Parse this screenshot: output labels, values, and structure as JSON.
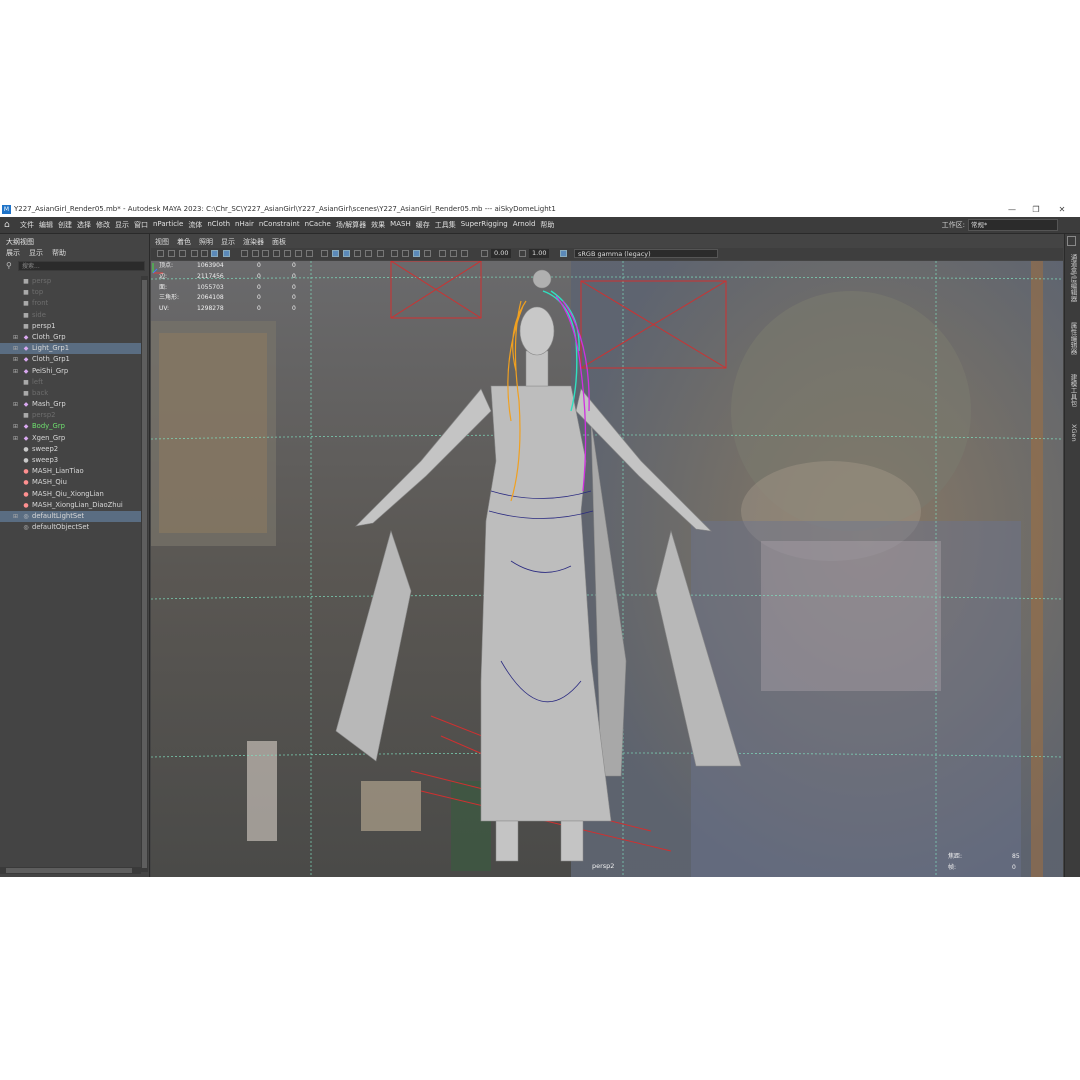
{
  "title_bar": {
    "text": "Y227_AsianGirl_Render05.mb* - Autodesk MAYA 2023: C:\\Chr_SC\\Y227_AsianGirl\\Y227_AsianGirl\\scenes\\Y227_AsianGirl_Render05.mb   ---   aiSkyDomeLight1",
    "icon": "maya-app-icon",
    "minimize": "—",
    "maximize": "❐",
    "close": "✕"
  },
  "menu_bar": {
    "items": [
      "文件",
      "编辑",
      "创建",
      "选择",
      "修改",
      "显示",
      "窗口",
      "nParticle",
      "流体",
      "nCloth",
      "nHair",
      "nConstraint",
      "nCache",
      "场/解算器",
      "效果",
      "MASH",
      "缓存",
      "工具集",
      "SuperRigging",
      "Arnold",
      "帮助"
    ],
    "workspace_label": "工作区:",
    "workspace_value": "常规*"
  },
  "outliner": {
    "title": "大纲视图",
    "menu": [
      "展示",
      "显示",
      "帮助"
    ],
    "search_placeholder": "搜索...",
    "items": [
      {
        "label": "persp",
        "icon": "camera-icon",
        "dim": true
      },
      {
        "label": "top",
        "icon": "camera-icon",
        "dim": true
      },
      {
        "label": "front",
        "icon": "camera-icon",
        "dim": true
      },
      {
        "label": "side",
        "icon": "camera-icon",
        "dim": true
      },
      {
        "label": "persp1",
        "icon": "camera-icon"
      },
      {
        "label": "Cloth_Grp",
        "icon": "group-icon",
        "expand": true
      },
      {
        "label": "Light_Grp1",
        "icon": "group-icon",
        "expand": true,
        "selected": true
      },
      {
        "label": "Cloth_Grp1",
        "icon": "group-icon",
        "expand": true
      },
      {
        "label": "PeiShi_Grp",
        "icon": "group-icon",
        "expand": true
      },
      {
        "label": "left",
        "icon": "camera-icon",
        "dim": true
      },
      {
        "label": "back",
        "icon": "camera-icon",
        "dim": true
      },
      {
        "label": "Mash_Grp",
        "icon": "group-icon",
        "expand": true
      },
      {
        "label": "persp2",
        "icon": "camera-icon",
        "dim": true
      },
      {
        "label": "Body_Grp",
        "icon": "group-icon",
        "expand": true,
        "green": true
      },
      {
        "label": "Xgen_Grp",
        "icon": "group-icon",
        "expand": true
      },
      {
        "label": "sweep2",
        "icon": "sweep-icon"
      },
      {
        "label": "sweep3",
        "icon": "sweep-icon"
      },
      {
        "label": "MASH_LianTiao",
        "icon": "mash-icon"
      },
      {
        "label": "MASH_Qiu",
        "icon": "mash-icon"
      },
      {
        "label": "MASH_Qiu_XiongLian",
        "icon": "mash-icon"
      },
      {
        "label": "MASH_XiongLian_DiaoZhui",
        "icon": "mash-icon"
      },
      {
        "label": "defaultLightSet",
        "icon": "set-icon",
        "expand": true,
        "selected": true
      },
      {
        "label": "defaultObjectSet",
        "icon": "set-icon"
      }
    ]
  },
  "viewport": {
    "menu": [
      "视图",
      "着色",
      "照明",
      "显示",
      "渲染器",
      "面板"
    ],
    "exposure": "0.00",
    "gamma": "1.00",
    "color_space": "sRGB gamma (legacy)",
    "camera_name": "persp2",
    "hud_stats": [
      {
        "label": "顶点:",
        "v1": "1063904",
        "v2": "0",
        "v3": "0"
      },
      {
        "label": "边:",
        "v1": "2117456",
        "v2": "0",
        "v3": "0"
      },
      {
        "label": "面:",
        "v1": "1055703",
        "v2": "0",
        "v3": "0"
      },
      {
        "label": "三角形:",
        "v1": "2064108",
        "v2": "0",
        "v3": "0"
      },
      {
        "label": "UV:",
        "v1": "1298278",
        "v2": "0",
        "v3": "0"
      }
    ],
    "hud_right": [
      {
        "label": "焦距:",
        "value": "85"
      },
      {
        "label": "帧:",
        "value": "0"
      }
    ]
  },
  "right_tabs": [
    "通道盒/层编辑器",
    "属性编辑器",
    "建模工具包",
    "XGen"
  ]
}
